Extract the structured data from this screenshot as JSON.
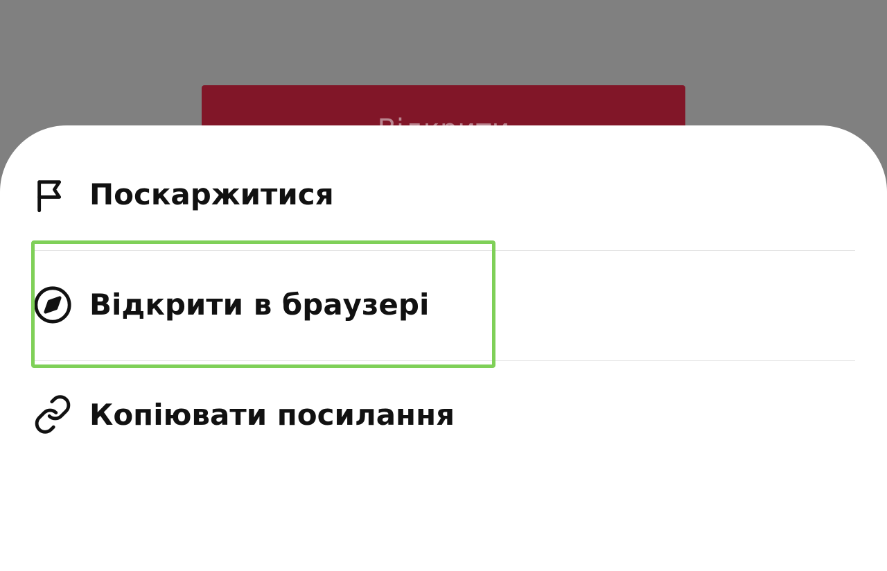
{
  "background_button": {
    "label": "Відкрити",
    "color": "#811628"
  },
  "menu": {
    "items": [
      {
        "label": "Поскаржитися",
        "icon": "flag-icon"
      },
      {
        "label": "Відкрити в браузері",
        "icon": "compass-icon"
      },
      {
        "label": "Копіювати посилання",
        "icon": "link-icon"
      }
    ]
  },
  "highlight": {
    "color": "#7fd058",
    "target": "Відкрити в браузері"
  }
}
